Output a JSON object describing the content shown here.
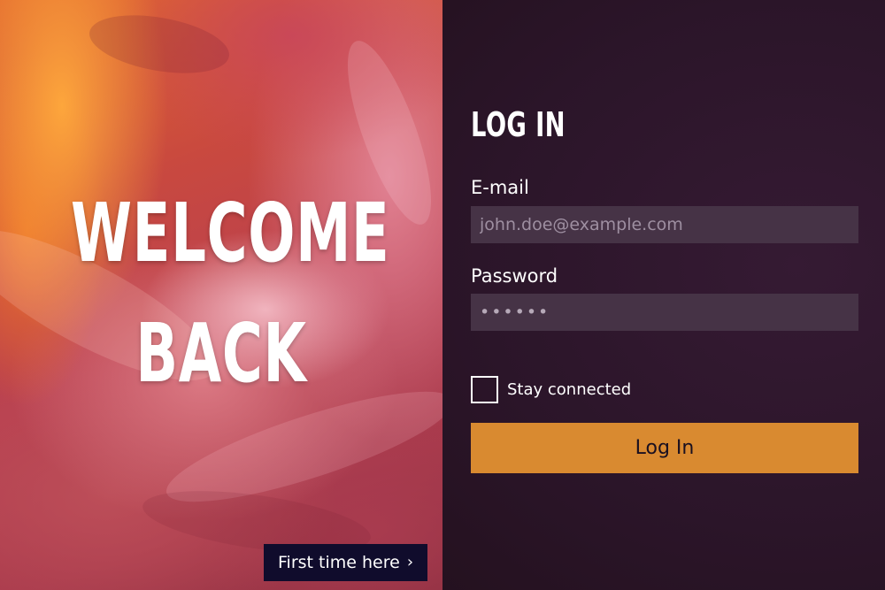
{
  "hero": {
    "title_line1": "WELCOME",
    "title_line2": "BACK",
    "first_time_label": "First time here",
    "first_time_icon": "chevron-right-icon"
  },
  "login_form": {
    "heading": "LOG IN",
    "email": {
      "label": "E-mail",
      "placeholder": "john.doe@example.com",
      "value": ""
    },
    "password": {
      "label": "Password",
      "value": "••••••"
    },
    "stay_connected": {
      "label": "Stay connected",
      "checked": false
    },
    "submit_label": "Log In"
  },
  "colors": {
    "panel_background": "#2b1529",
    "input_background": "#463346",
    "button_accent": "#d98a30",
    "first_time_background": "#100c2c",
    "text": "#ffffff"
  }
}
